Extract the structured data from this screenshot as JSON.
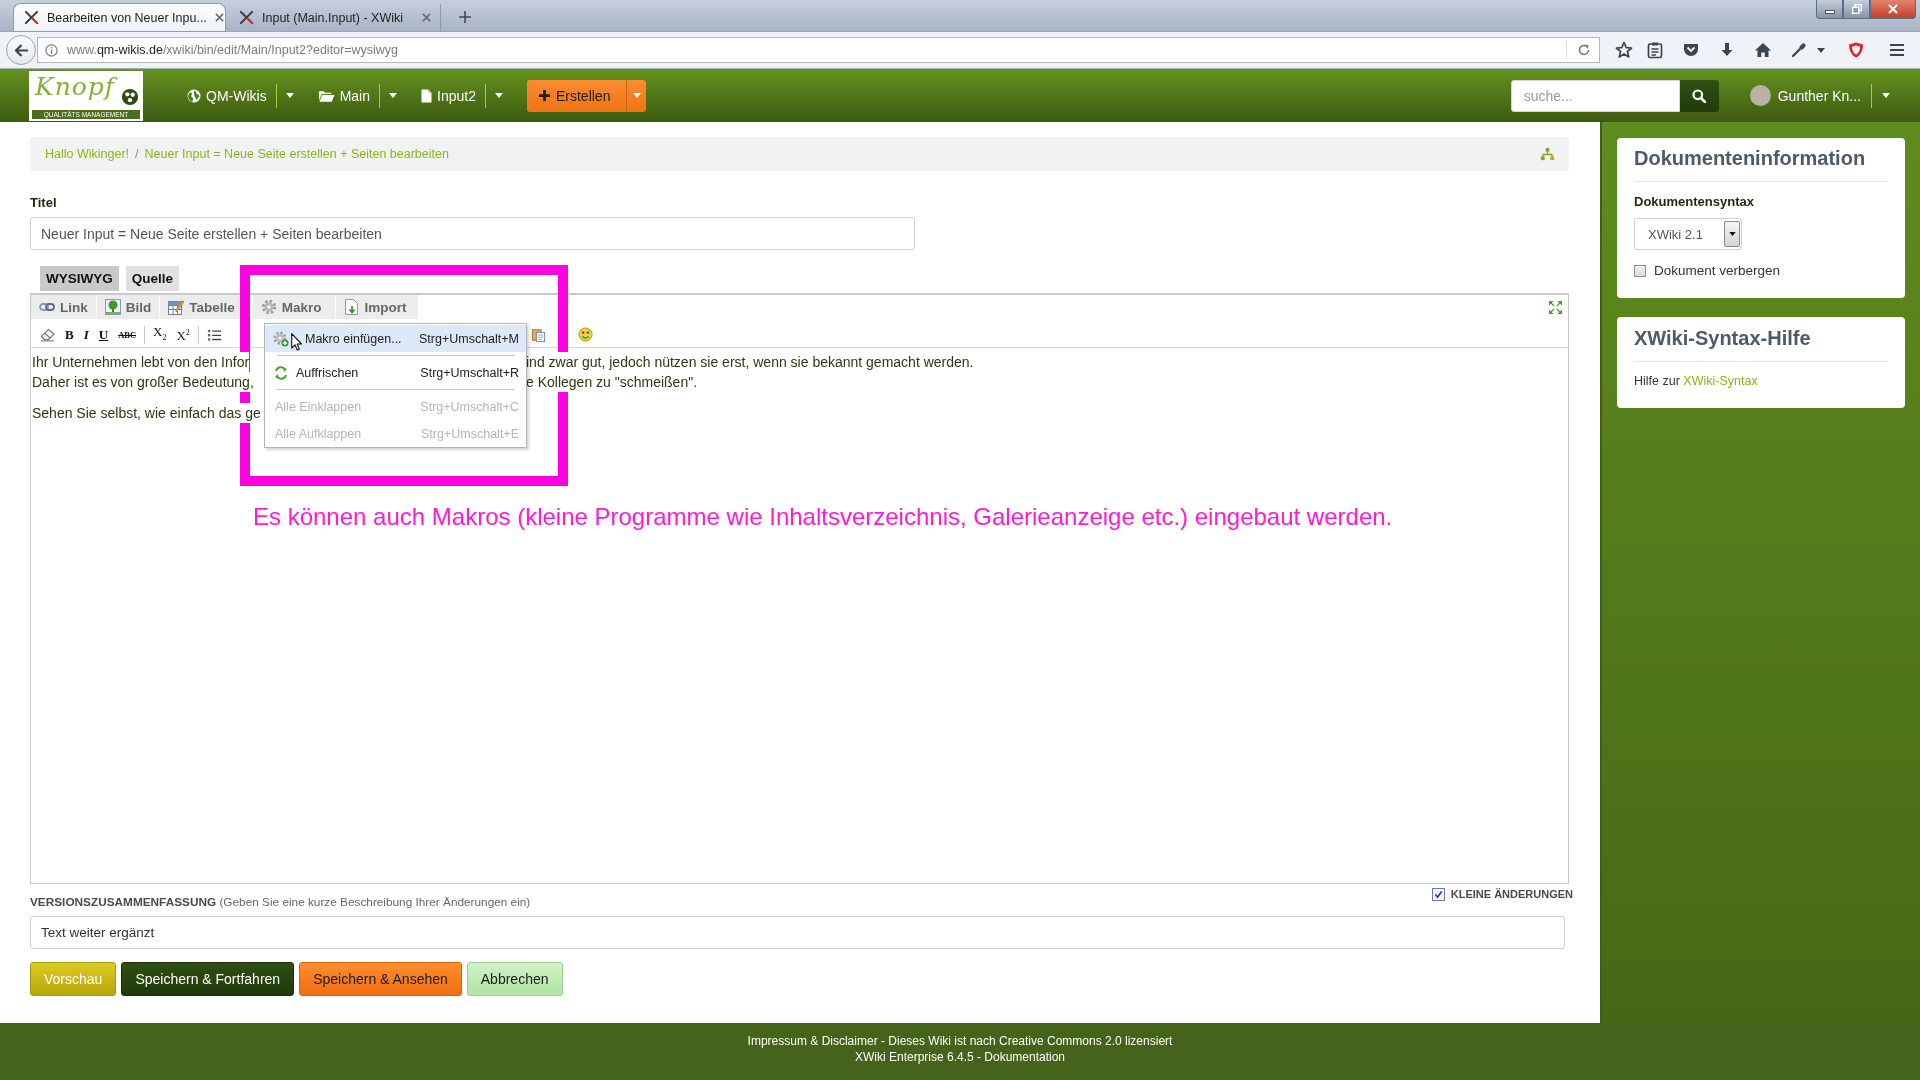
{
  "browser": {
    "tabs": [
      {
        "title": "Bearbeiten von Neuer Inpu...",
        "selected": true
      },
      {
        "title": "Input (Main.Input) - XWiki",
        "selected": false
      }
    ],
    "url": "www.**qm-wikis.de**/xwiki/bin/edit/Main/Input2?editor=wysiwyg"
  },
  "navbar": {
    "logo": {
      "name": "Knopf",
      "tagline": "QUALITÄTS MANAGEMENT"
    },
    "menus": [
      {
        "kind": "wiki",
        "label": "QM-Wikis"
      },
      {
        "kind": "space",
        "label": "Main"
      },
      {
        "kind": "page",
        "label": "Input2"
      }
    ],
    "create_button": "Erstellen",
    "search": {
      "placeholder": "suche..."
    },
    "user": "Gunther Kn..."
  },
  "breadcrumb": {
    "separator": "/",
    "items": [
      "Hallo Wikinger!",
      "Neuer Input = Neue Seite erstellen + Seiten bearbeiten"
    ]
  },
  "title_field": {
    "label": "Titel",
    "value": "Neuer Input = Neue Seite erstellen + Seiten bearbeiten"
  },
  "editor_tabs": [
    {
      "label": "WYSIWYG",
      "selected": true
    },
    {
      "label": "Quelle",
      "selected": false
    }
  ],
  "editor": {
    "toolbar": [
      {
        "kind": "link",
        "label": "Link"
      },
      {
        "kind": "image",
        "label": "Bild"
      },
      {
        "kind": "table",
        "label": "Tabelle"
      },
      {
        "kind": "macro",
        "label": "Makro"
      },
      {
        "kind": "import",
        "label": "Import"
      }
    ],
    "format_left": [
      {
        "kind": "eraser"
      },
      {
        "kind": "bold",
        "label": "B"
      },
      {
        "kind": "italic",
        "label": "I"
      },
      {
        "kind": "underline",
        "label": "U"
      },
      {
        "kind": "strike",
        "label": "ABC"
      },
      {
        "kind": "separator"
      },
      {
        "kind": "subscript",
        "label": "X$_{2}$"
      },
      {
        "kind": "superscript",
        "label": "X$^{2}$"
      },
      {
        "kind": "separator"
      },
      {
        "kind": "bullets"
      }
    ],
    "format_right": [
      {
        "kind": "paste"
      },
      {
        "kind": "smiley"
      }
    ],
    "paragraphs": [
      [
        {
          "left": "Ihr Unternehmen lebt von den Infor",
          "right": "ind zwar gut, jedoch nützen sie erst, wenn sie bekannt gemacht werden."
        },
        {
          "left": "Daher ist es von großer Bedeutung,",
          "right": "e Kollegen zu \"schmeißen\"."
        }
      ],
      [
        {
          "left": "Sehen Sie selbst, wie einfach das ge"
        }
      ]
    ],
    "menu": [
      [
        {
          "kind": "insert",
          "label": "Makro einfügen...",
          "shortcut": "Strg+Umschalt+M",
          "selected": true,
          "disabled": false
        }
      ],
      [
        {
          "kind": "refresh",
          "label": "Auffrischen",
          "shortcut": "Strg+Umschalt+R",
          "selected": false,
          "disabled": false
        }
      ],
      [
        {
          "kind": "text",
          "label": "Alle Einklappen",
          "shortcut": "Strg+Umschalt+C",
          "selected": false,
          "disabled": true
        },
        {
          "kind": "text",
          "label": "Alle Aufklappen",
          "shortcut": "Strg+Umschalt+E",
          "selected": false,
          "disabled": true
        }
      ]
    ]
  },
  "annotation": "Es können auch Makros (kleine Programme wie Inhaltsverzeichnis, Galerieanzeige etc.) eingebaut werden.",
  "version_summary": {
    "label": "**VERSIONSZUSAMMENFASSUNG** (Geben Sie eine kurze Beschreibung Ihrer Änderungen ein)",
    "minor_edit": {
      "label": "KLEINE ÄNDERUNGEN",
      "checked": true
    },
    "value": "Text weiter ergänzt"
  },
  "buttons": [
    {
      "kind": "preview",
      "label": "Vorschau"
    },
    {
      "kind": "continue",
      "label": "Speichern & Fortfahren"
    },
    {
      "kind": "view",
      "label": "Speichern & Ansehen"
    },
    {
      "kind": "cancel",
      "label": "Abbrechen"
    }
  ],
  "sidebar": {
    "document_info": {
      "title": "Dokumenteninformation",
      "syntax_label": "Dokumentensyntax",
      "syntax": "XWiki 2.1",
      "hide_document": {
        "label": "Dokument verbergen",
        "checked": false
      }
    },
    "syntax_help": {
      "title": "XWiki-Syntax-Hilfe",
      "text": "Hilfe zur",
      "link": "XWiki-Syntax"
    }
  },
  "footer": [
    "Impressum & Disclaimer - Dieses Wiki ist nach Creative Commons 2.0 lizensiert",
    "XWiki Enterprise 6.4.5 - Dokumentation"
  ]
}
